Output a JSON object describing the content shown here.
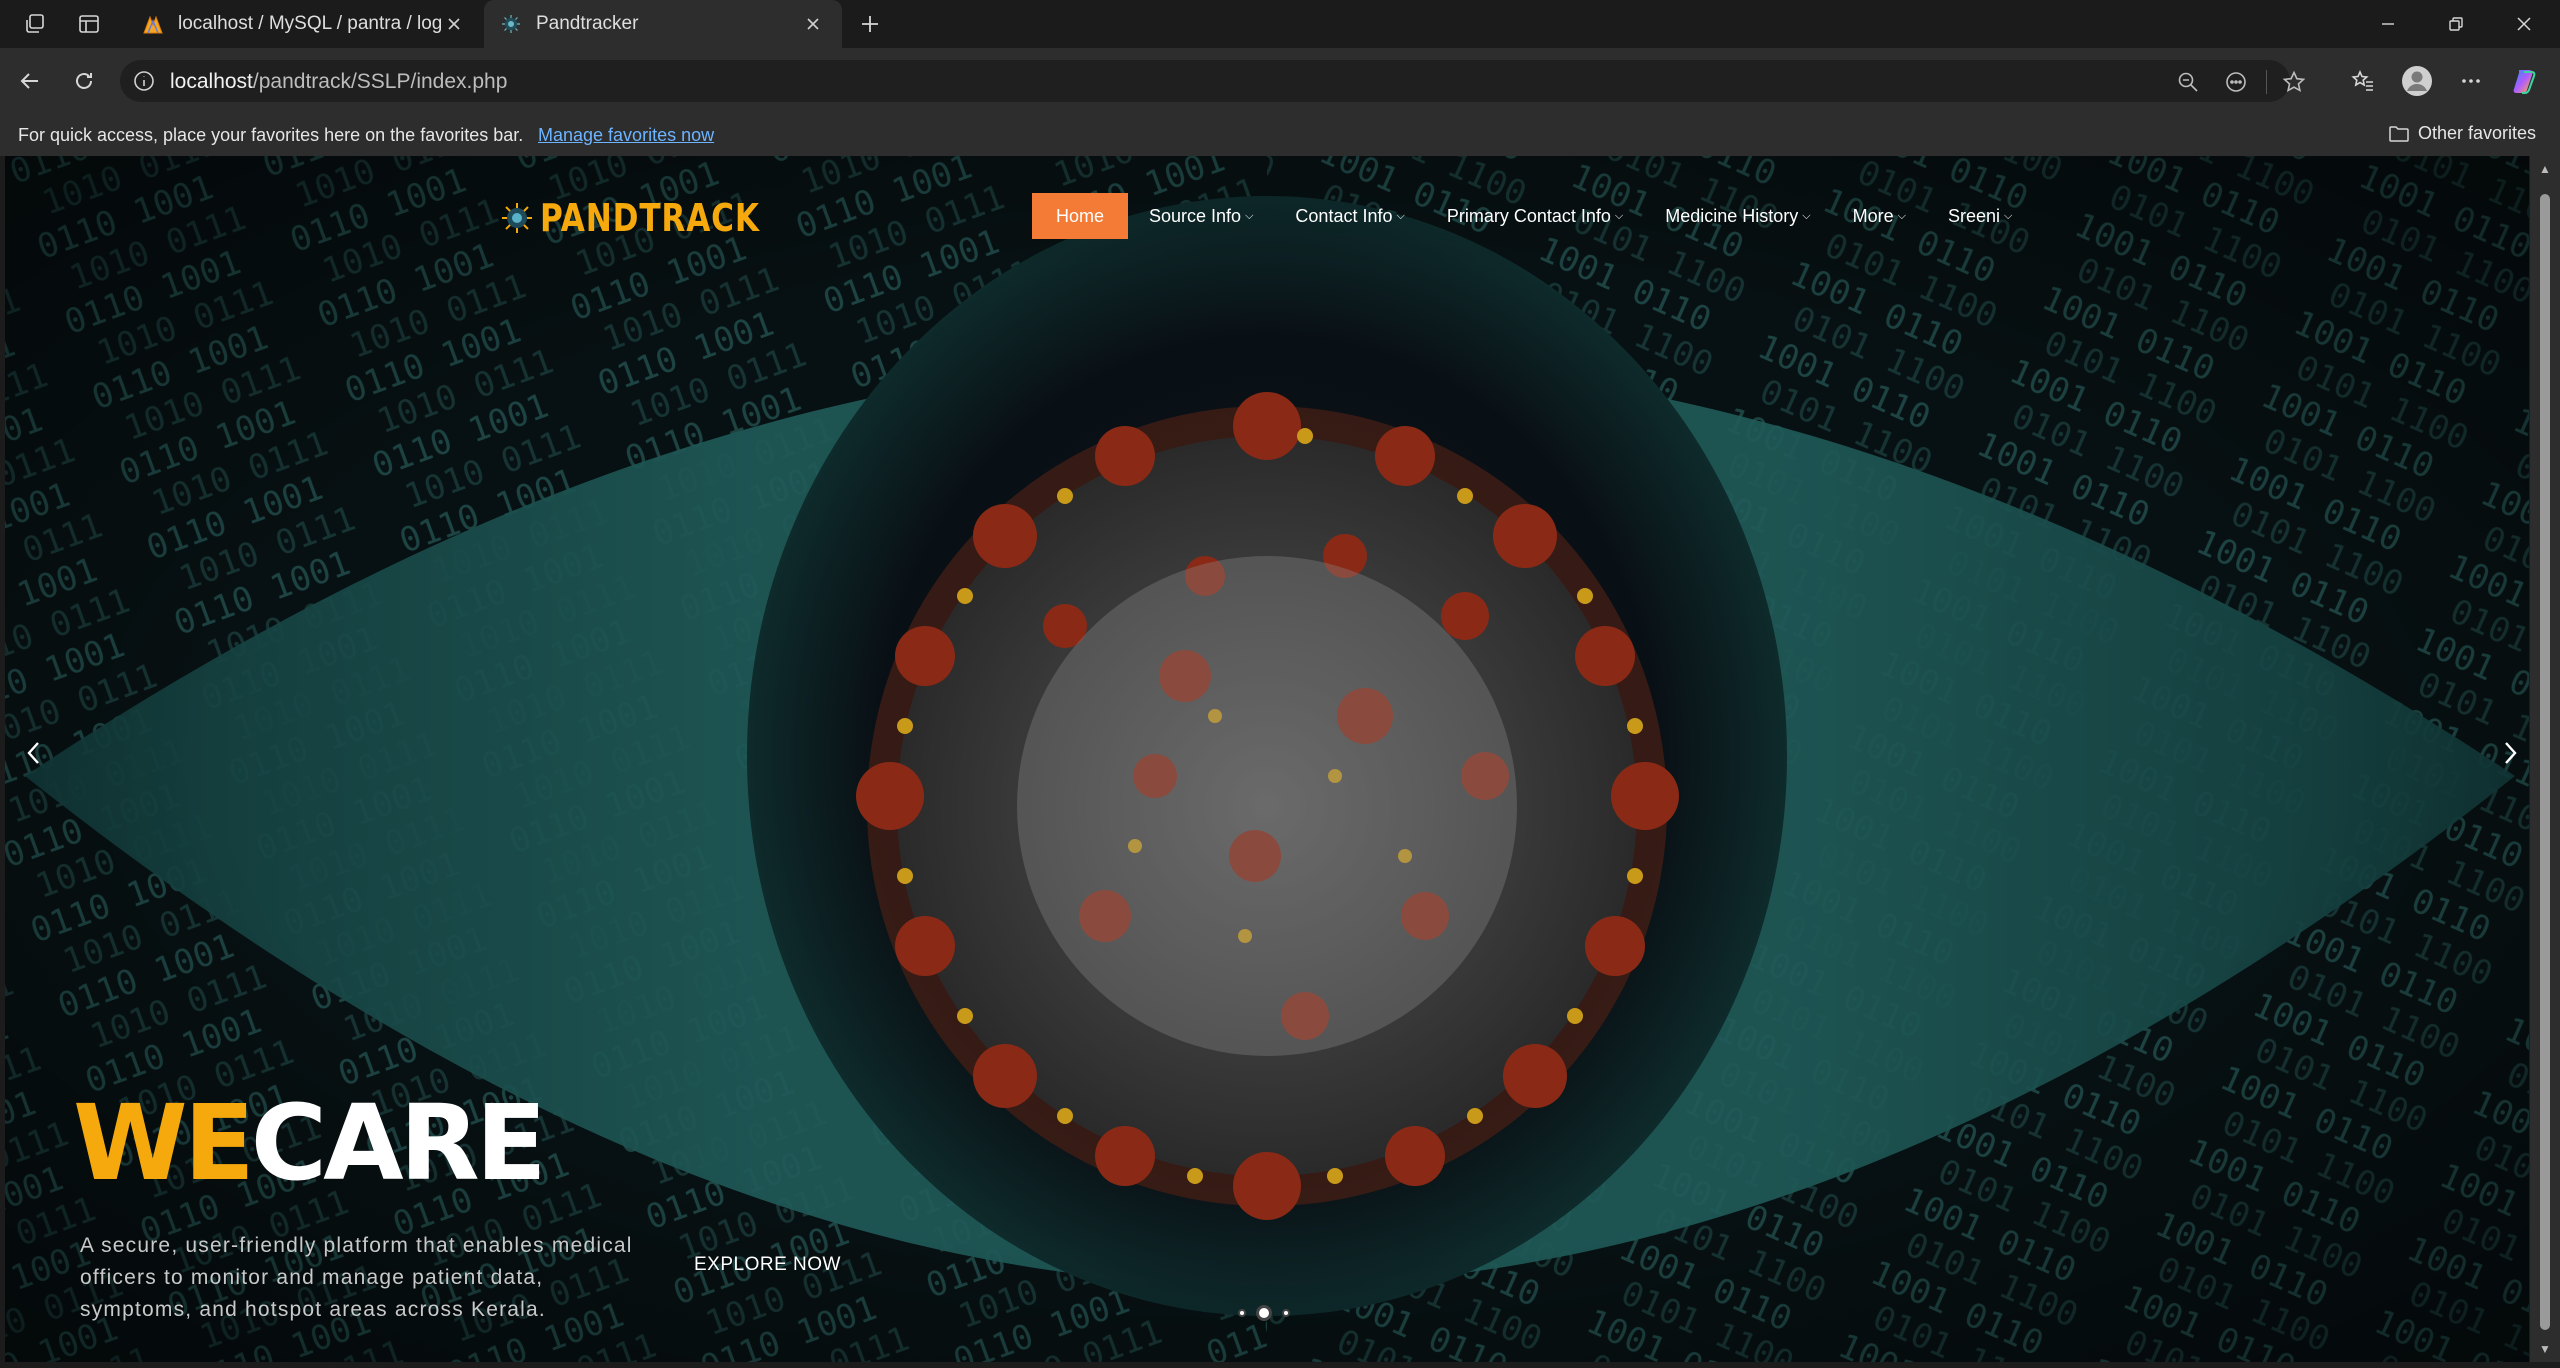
{
  "browser": {
    "tabs": [
      {
        "title": "localhost / MySQL / pantra / login",
        "active": false
      },
      {
        "title": "Pandtracker",
        "active": true
      }
    ],
    "url_host": "localhost",
    "url_path": "/pandtrack/SSLP/index.php",
    "favorites_message": "For quick access, place your favorites here on the favorites bar.",
    "favorites_link": "Manage favorites now",
    "other_favorites": "Other favorites"
  },
  "site": {
    "logo_text": "PANDTRACK",
    "nav": [
      {
        "label": "Home",
        "active": true,
        "dropdown": false
      },
      {
        "label": "Source Info",
        "dropdown": true
      },
      {
        "label": "Contact Info",
        "dropdown": true
      },
      {
        "label": "Primary Contact Info",
        "dropdown": true
      },
      {
        "label": "Medicine History",
        "dropdown": true
      },
      {
        "label": "More",
        "dropdown": true
      },
      {
        "label": "Sreeni",
        "dropdown": true
      }
    ],
    "hero": {
      "title_accent": "WE",
      "title_rest": "CARE",
      "tagline": "A secure, user-friendly platform that enables medical officers to monitor and manage patient data, symptoms, and hotspot areas across Kerala.",
      "cta": "EXPLORE NOW",
      "slide_count": 3,
      "active_slide": 2
    }
  },
  "colors": {
    "accent_orange": "#f47b35",
    "logo_gold": "#f5a90d",
    "eye_teal": "#1f5a58"
  }
}
